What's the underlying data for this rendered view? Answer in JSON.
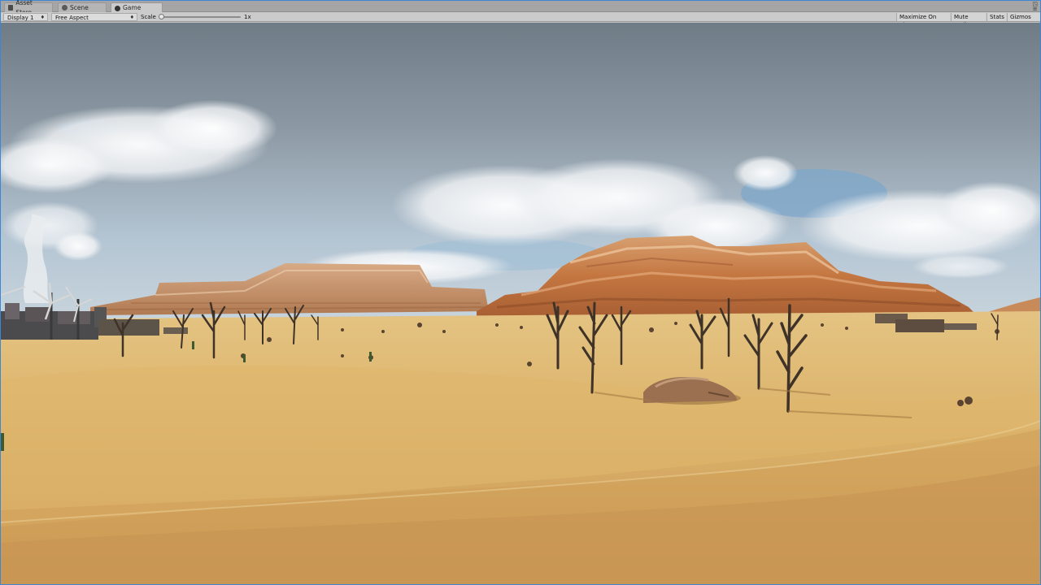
{
  "tabs": [
    {
      "label": "Asset Store",
      "icon": "asset-store-icon",
      "active": false
    },
    {
      "label": "Scene",
      "icon": "scene-icon",
      "active": false
    },
    {
      "label": "Game",
      "icon": "game-icon",
      "active": true
    }
  ],
  "toolbar": {
    "display": "Display 1",
    "aspect": "Free Aspect",
    "scale_label": "Scale",
    "scale_value": "1x",
    "maximize_on_play": "Maximize On Play",
    "mute_audio": "Mute Audio",
    "stats": "Stats",
    "gizmos": "Gizmos"
  },
  "colors": {
    "editor_border": "#3d86d4",
    "sky_top": "#7d8a95",
    "sky_horizon": "#b9c9d6",
    "sand": "#d9b36a",
    "mesa": "#c9824a"
  }
}
